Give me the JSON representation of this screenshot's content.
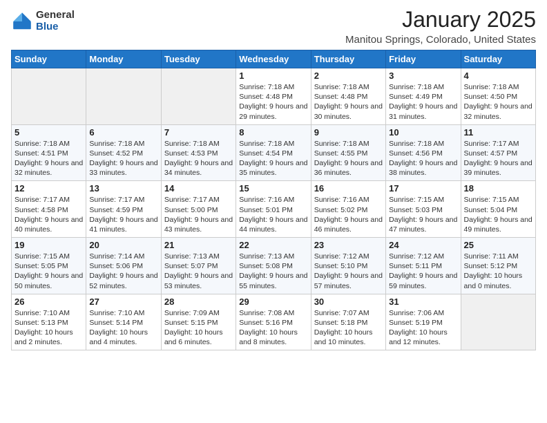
{
  "logo": {
    "general": "General",
    "blue": "Blue"
  },
  "header": {
    "month": "January 2025",
    "location": "Manitou Springs, Colorado, United States"
  },
  "weekdays": [
    "Sunday",
    "Monday",
    "Tuesday",
    "Wednesday",
    "Thursday",
    "Friday",
    "Saturday"
  ],
  "weeks": [
    [
      {
        "day": null,
        "sunrise": null,
        "sunset": null,
        "daylight": null
      },
      {
        "day": null,
        "sunrise": null,
        "sunset": null,
        "daylight": null
      },
      {
        "day": null,
        "sunrise": null,
        "sunset": null,
        "daylight": null
      },
      {
        "day": "1",
        "sunrise": "Sunrise: 7:18 AM",
        "sunset": "Sunset: 4:48 PM",
        "daylight": "Daylight: 9 hours and 29 minutes."
      },
      {
        "day": "2",
        "sunrise": "Sunrise: 7:18 AM",
        "sunset": "Sunset: 4:48 PM",
        "daylight": "Daylight: 9 hours and 30 minutes."
      },
      {
        "day": "3",
        "sunrise": "Sunrise: 7:18 AM",
        "sunset": "Sunset: 4:49 PM",
        "daylight": "Daylight: 9 hours and 31 minutes."
      },
      {
        "day": "4",
        "sunrise": "Sunrise: 7:18 AM",
        "sunset": "Sunset: 4:50 PM",
        "daylight": "Daylight: 9 hours and 32 minutes."
      }
    ],
    [
      {
        "day": "5",
        "sunrise": "Sunrise: 7:18 AM",
        "sunset": "Sunset: 4:51 PM",
        "daylight": "Daylight: 9 hours and 32 minutes."
      },
      {
        "day": "6",
        "sunrise": "Sunrise: 7:18 AM",
        "sunset": "Sunset: 4:52 PM",
        "daylight": "Daylight: 9 hours and 33 minutes."
      },
      {
        "day": "7",
        "sunrise": "Sunrise: 7:18 AM",
        "sunset": "Sunset: 4:53 PM",
        "daylight": "Daylight: 9 hours and 34 minutes."
      },
      {
        "day": "8",
        "sunrise": "Sunrise: 7:18 AM",
        "sunset": "Sunset: 4:54 PM",
        "daylight": "Daylight: 9 hours and 35 minutes."
      },
      {
        "day": "9",
        "sunrise": "Sunrise: 7:18 AM",
        "sunset": "Sunset: 4:55 PM",
        "daylight": "Daylight: 9 hours and 36 minutes."
      },
      {
        "day": "10",
        "sunrise": "Sunrise: 7:18 AM",
        "sunset": "Sunset: 4:56 PM",
        "daylight": "Daylight: 9 hours and 38 minutes."
      },
      {
        "day": "11",
        "sunrise": "Sunrise: 7:17 AM",
        "sunset": "Sunset: 4:57 PM",
        "daylight": "Daylight: 9 hours and 39 minutes."
      }
    ],
    [
      {
        "day": "12",
        "sunrise": "Sunrise: 7:17 AM",
        "sunset": "Sunset: 4:58 PM",
        "daylight": "Daylight: 9 hours and 40 minutes."
      },
      {
        "day": "13",
        "sunrise": "Sunrise: 7:17 AM",
        "sunset": "Sunset: 4:59 PM",
        "daylight": "Daylight: 9 hours and 41 minutes."
      },
      {
        "day": "14",
        "sunrise": "Sunrise: 7:17 AM",
        "sunset": "Sunset: 5:00 PM",
        "daylight": "Daylight: 9 hours and 43 minutes."
      },
      {
        "day": "15",
        "sunrise": "Sunrise: 7:16 AM",
        "sunset": "Sunset: 5:01 PM",
        "daylight": "Daylight: 9 hours and 44 minutes."
      },
      {
        "day": "16",
        "sunrise": "Sunrise: 7:16 AM",
        "sunset": "Sunset: 5:02 PM",
        "daylight": "Daylight: 9 hours and 46 minutes."
      },
      {
        "day": "17",
        "sunrise": "Sunrise: 7:15 AM",
        "sunset": "Sunset: 5:03 PM",
        "daylight": "Daylight: 9 hours and 47 minutes."
      },
      {
        "day": "18",
        "sunrise": "Sunrise: 7:15 AM",
        "sunset": "Sunset: 5:04 PM",
        "daylight": "Daylight: 9 hours and 49 minutes."
      }
    ],
    [
      {
        "day": "19",
        "sunrise": "Sunrise: 7:15 AM",
        "sunset": "Sunset: 5:05 PM",
        "daylight": "Daylight: 9 hours and 50 minutes."
      },
      {
        "day": "20",
        "sunrise": "Sunrise: 7:14 AM",
        "sunset": "Sunset: 5:06 PM",
        "daylight": "Daylight: 9 hours and 52 minutes."
      },
      {
        "day": "21",
        "sunrise": "Sunrise: 7:13 AM",
        "sunset": "Sunset: 5:07 PM",
        "daylight": "Daylight: 9 hours and 53 minutes."
      },
      {
        "day": "22",
        "sunrise": "Sunrise: 7:13 AM",
        "sunset": "Sunset: 5:08 PM",
        "daylight": "Daylight: 9 hours and 55 minutes."
      },
      {
        "day": "23",
        "sunrise": "Sunrise: 7:12 AM",
        "sunset": "Sunset: 5:10 PM",
        "daylight": "Daylight: 9 hours and 57 minutes."
      },
      {
        "day": "24",
        "sunrise": "Sunrise: 7:12 AM",
        "sunset": "Sunset: 5:11 PM",
        "daylight": "Daylight: 9 hours and 59 minutes."
      },
      {
        "day": "25",
        "sunrise": "Sunrise: 7:11 AM",
        "sunset": "Sunset: 5:12 PM",
        "daylight": "Daylight: 10 hours and 0 minutes."
      }
    ],
    [
      {
        "day": "26",
        "sunrise": "Sunrise: 7:10 AM",
        "sunset": "Sunset: 5:13 PM",
        "daylight": "Daylight: 10 hours and 2 minutes."
      },
      {
        "day": "27",
        "sunrise": "Sunrise: 7:10 AM",
        "sunset": "Sunset: 5:14 PM",
        "daylight": "Daylight: 10 hours and 4 minutes."
      },
      {
        "day": "28",
        "sunrise": "Sunrise: 7:09 AM",
        "sunset": "Sunset: 5:15 PM",
        "daylight": "Daylight: 10 hours and 6 minutes."
      },
      {
        "day": "29",
        "sunrise": "Sunrise: 7:08 AM",
        "sunset": "Sunset: 5:16 PM",
        "daylight": "Daylight: 10 hours and 8 minutes."
      },
      {
        "day": "30",
        "sunrise": "Sunrise: 7:07 AM",
        "sunset": "Sunset: 5:18 PM",
        "daylight": "Daylight: 10 hours and 10 minutes."
      },
      {
        "day": "31",
        "sunrise": "Sunrise: 7:06 AM",
        "sunset": "Sunset: 5:19 PM",
        "daylight": "Daylight: 10 hours and 12 minutes."
      },
      {
        "day": null,
        "sunrise": null,
        "sunset": null,
        "daylight": null
      }
    ]
  ]
}
